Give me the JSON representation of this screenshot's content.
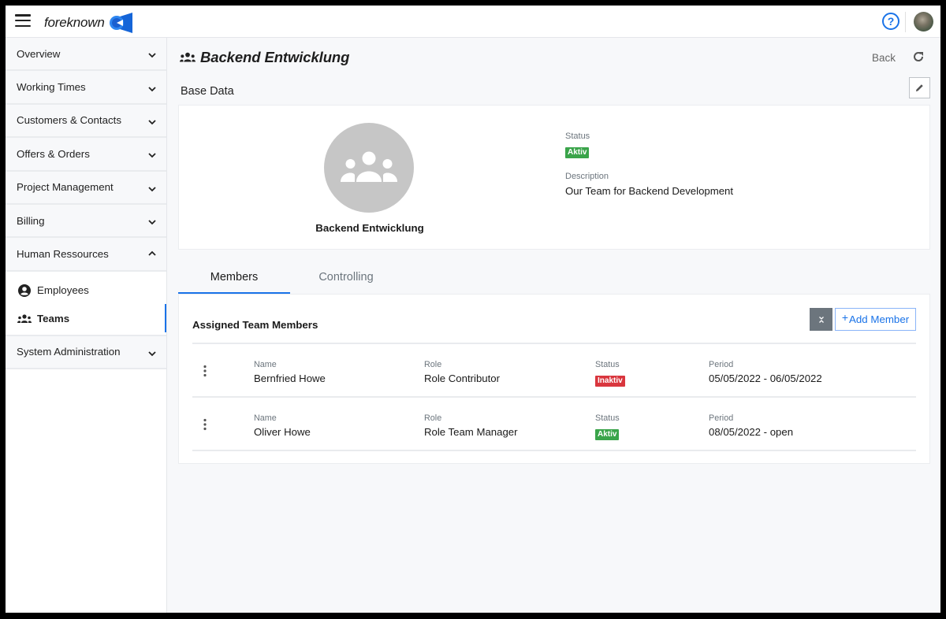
{
  "app": {
    "brand": "foreknown"
  },
  "sidebar": {
    "items": [
      {
        "label": "Overview",
        "state": "collapsed"
      },
      {
        "label": "Working Times",
        "state": "collapsed"
      },
      {
        "label": "Customers & Contacts",
        "state": "collapsed"
      },
      {
        "label": "Offers & Orders",
        "state": "collapsed"
      },
      {
        "label": "Project Management",
        "state": "collapsed"
      },
      {
        "label": "Billing",
        "state": "collapsed"
      },
      {
        "label": "Human Ressources",
        "state": "expanded"
      },
      {
        "label": "System Administration",
        "state": "collapsed"
      }
    ],
    "subitems": [
      {
        "label": "Employees",
        "icon": "user-circle-icon"
      },
      {
        "label": "Teams",
        "icon": "users-icon",
        "active": true
      }
    ]
  },
  "header": {
    "title": "Backend Entwicklung",
    "back_label": "Back"
  },
  "base_data": {
    "section_label": "Base Data",
    "team_name": "Backend Entwicklung",
    "status_label": "Status",
    "status_value": "Aktiv",
    "description_label": "Description",
    "description_value": "Our Team for Backend Development"
  },
  "tabs": [
    {
      "label": "Members",
      "active": true
    },
    {
      "label": "Controlling",
      "active": false
    }
  ],
  "members": {
    "title": "Assigned Team Members",
    "add_label": "Add Member",
    "add_prefix": "+",
    "columns": {
      "name": "Name",
      "role": "Role",
      "status": "Status",
      "period": "Period"
    },
    "rows": [
      {
        "name": "Bernfried Howe",
        "role": "Role Contributor",
        "status": "Inaktiv",
        "status_color": "#d9363e",
        "period": "05/05/2022 - 06/05/2022"
      },
      {
        "name": "Oliver Howe",
        "role": "Role Team Manager",
        "status": "Aktiv",
        "status_color": "#3aa44a",
        "period": "08/05/2022 - open"
      }
    ]
  },
  "colors": {
    "accent": "#1a73e8",
    "active_badge": "#3aa44a",
    "inactive_badge": "#d9363e"
  }
}
